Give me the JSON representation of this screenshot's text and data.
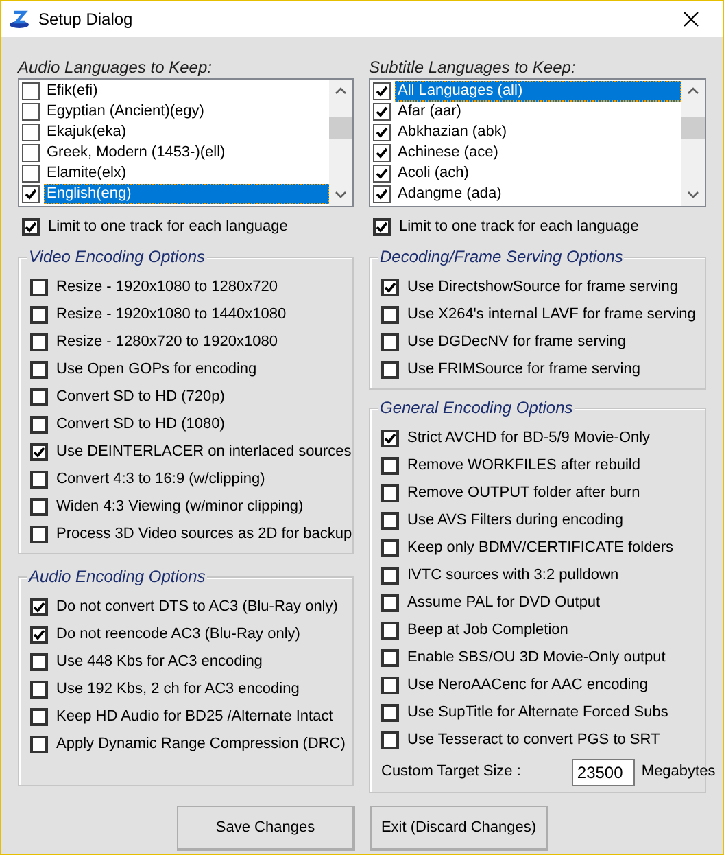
{
  "window": {
    "title": "Setup Dialog"
  },
  "audio_languages": {
    "label": "Audio Languages to Keep:",
    "items": [
      {
        "label": "Efik(efi)",
        "checked": false,
        "selected": false
      },
      {
        "label": "Egyptian (Ancient)(egy)",
        "checked": false,
        "selected": false
      },
      {
        "label": "Ekajuk(eka)",
        "checked": false,
        "selected": false
      },
      {
        "label": "Greek, Modern (1453-)(ell)",
        "checked": false,
        "selected": false
      },
      {
        "label": "Elamite(elx)",
        "checked": false,
        "selected": false
      },
      {
        "label": "English(eng)",
        "checked": true,
        "selected": true
      }
    ],
    "limit": {
      "label": "Limit to one track for each language",
      "checked": true
    }
  },
  "subtitle_languages": {
    "label": "Subtitle Languages to Keep:",
    "items": [
      {
        "label": "All Languages (all)",
        "checked": true,
        "selected": true
      },
      {
        "label": "Afar (aar)",
        "checked": true,
        "selected": false
      },
      {
        "label": "Abkhazian (abk)",
        "checked": true,
        "selected": false
      },
      {
        "label": "Achinese (ace)",
        "checked": true,
        "selected": false
      },
      {
        "label": "Acoli (ach)",
        "checked": true,
        "selected": false
      },
      {
        "label": "Adangme (ada)",
        "checked": true,
        "selected": false
      }
    ],
    "limit": {
      "label": "Limit to one track for each language",
      "checked": true
    }
  },
  "video_encoding": {
    "title": "Video Encoding Options",
    "options": [
      {
        "label": "Resize  - 1920x1080 to 1280x720",
        "checked": false
      },
      {
        "label": "Resize  - 1920x1080 to 1440x1080",
        "checked": false
      },
      {
        "label": "Resize  - 1280x720 to 1920x1080",
        "checked": false
      },
      {
        "label": "Use Open GOPs for encoding",
        "checked": false
      },
      {
        "label": "Convert SD to HD (720p)",
        "checked": false
      },
      {
        "label": "Convert SD to HD (1080)",
        "checked": false
      },
      {
        "label": "Use DEINTERLACER on interlaced sources",
        "checked": true
      },
      {
        "label": "Convert 4:3 to 16:9 (w/clipping)",
        "checked": false
      },
      {
        "label": "Widen 4:3 Viewing (w/minor clipping)",
        "checked": false
      },
      {
        "label": "Process 3D Video sources as 2D for backup",
        "checked": false
      }
    ]
  },
  "audio_encoding": {
    "title": "Audio Encoding Options",
    "options": [
      {
        "label": "Do not convert DTS to AC3  (Blu-Ray only)",
        "checked": true
      },
      {
        "label": "Do not reencode AC3  (Blu-Ray only)",
        "checked": true
      },
      {
        "label": "Use 448 Kbs for AC3 encoding",
        "checked": false
      },
      {
        "label": "Use 192 Kbs, 2 ch for AC3 encoding",
        "checked": false
      },
      {
        "label": "Keep HD Audio for BD25 /Alternate Intact",
        "checked": false
      },
      {
        "label": "Apply Dynamic Range Compression (DRC)",
        "checked": false
      }
    ]
  },
  "decoding": {
    "title": "Decoding/Frame Serving Options",
    "options": [
      {
        "label": "Use DirectshowSource for frame serving",
        "checked": true
      },
      {
        "label": "Use X264's internal LAVF for frame serving",
        "checked": false
      },
      {
        "label": "Use DGDecNV for frame serving",
        "checked": false
      },
      {
        "label": "Use FRIMSource for frame serving",
        "checked": false
      }
    ]
  },
  "general_encoding": {
    "title": "General Encoding Options",
    "options": [
      {
        "label": "Strict AVCHD for BD-5/9 Movie-Only",
        "checked": true
      },
      {
        "label": "Remove WORKFILES after rebuild",
        "checked": false
      },
      {
        "label": "Remove OUTPUT folder after burn",
        "checked": false
      },
      {
        "label": "Use AVS Filters during encoding",
        "checked": false
      },
      {
        "label": "Keep only BDMV/CERTIFICATE folders",
        "checked": false
      },
      {
        "label": "IVTC sources with 3:2 pulldown",
        "checked": false
      },
      {
        "label": "Assume PAL for DVD Output",
        "checked": false
      },
      {
        "label": "Beep at Job Completion",
        "checked": false
      },
      {
        "label": "Enable SBS/OU 3D Movie-Only output",
        "checked": false
      },
      {
        "label": "Use NeroAACenc for AAC encoding",
        "checked": false
      },
      {
        "label": "Use SupTitle for Alternate Forced Subs",
        "checked": false
      },
      {
        "label": "Use Tesseract to convert PGS to SRT",
        "checked": false
      }
    ],
    "custom_target_size": {
      "label": "Custom Target Size :",
      "value": "23500",
      "unit": "Megabytes"
    }
  },
  "buttons": [
    {
      "label": "Save Changes"
    },
    {
      "label": "Exit (Discard Changes)"
    }
  ]
}
